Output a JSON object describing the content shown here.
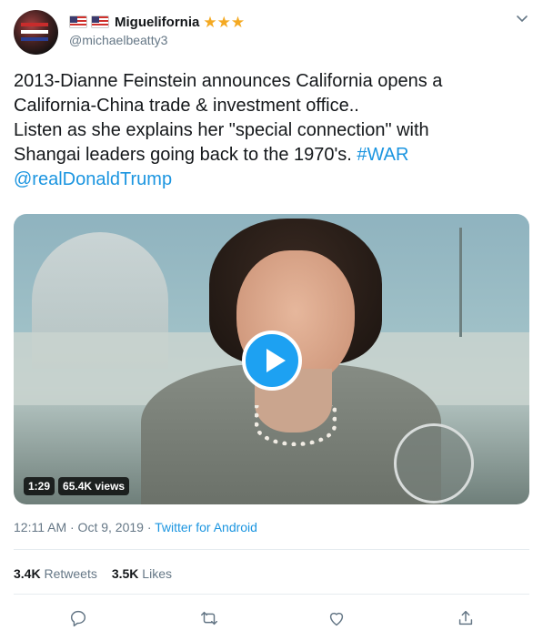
{
  "user": {
    "display_name": "Miguelifornia",
    "stars": "★★★",
    "handle": "@michaelbeatty3"
  },
  "tweet": {
    "line1": "2013-Dianne Feinstein announces California opens a",
    "line2": "California-China trade & investment office..",
    "line3": "Listen as she explains her \"special connection\" with",
    "line4_text": "Shangai leaders going back to the 1970's. ",
    "hashtag": "#WAR",
    "mention": "@realDonaldTrump"
  },
  "video": {
    "duration": "1:29",
    "views": "65.4K views"
  },
  "meta": {
    "time": "12:11 AM · Oct 9, 2019 · ",
    "client": "Twitter for Android"
  },
  "stats": {
    "retweets_count": "3.4K",
    "retweets_label": "Retweets",
    "likes_count": "3.5K",
    "likes_label": "Likes"
  },
  "colors": {
    "accent": "#1da1f2",
    "link": "#1b95e0",
    "muted": "#657786",
    "star": "#f4a922"
  },
  "icons": [
    "reply-icon",
    "retweet-icon",
    "like-icon",
    "share-icon",
    "chevron-down-icon",
    "play-icon"
  ]
}
